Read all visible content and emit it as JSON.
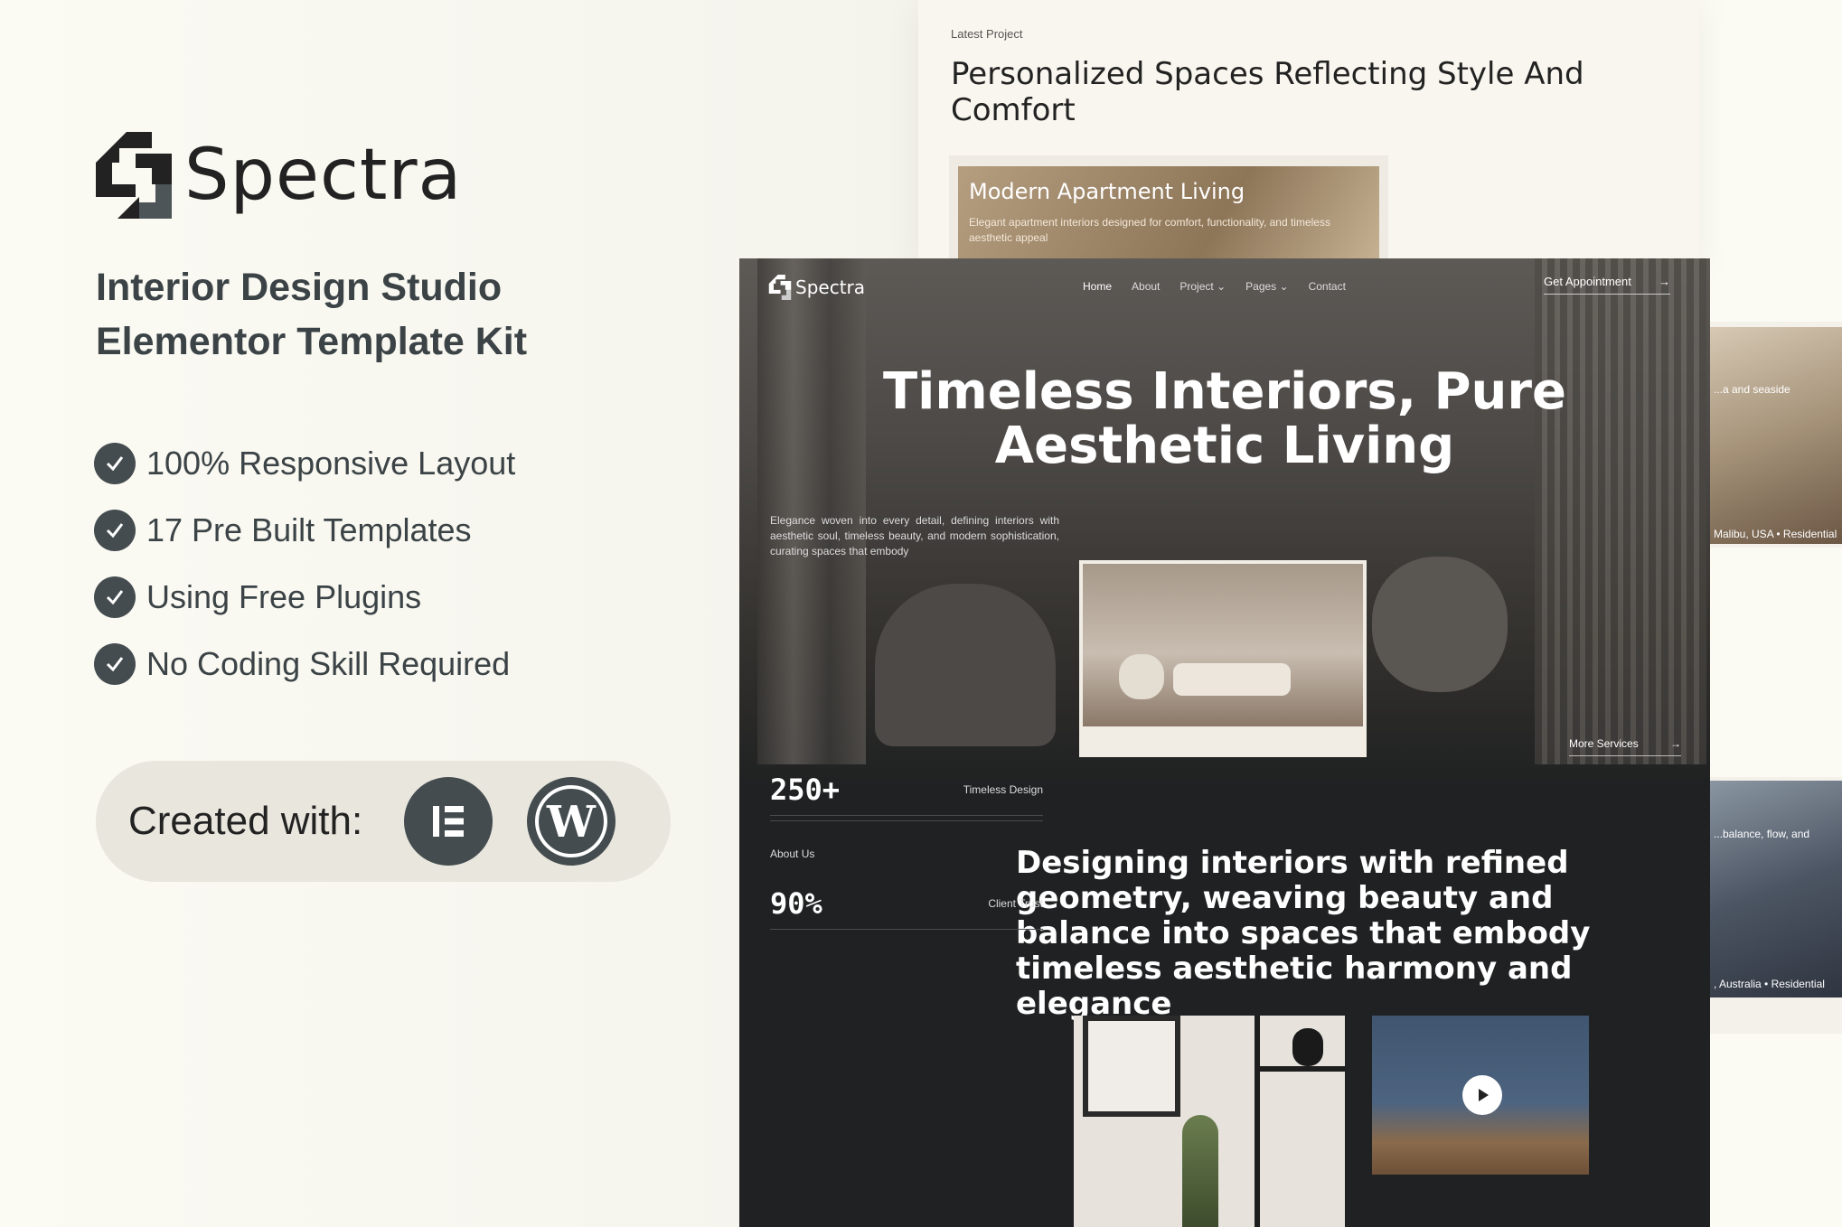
{
  "promo": {
    "brand": "Spectra",
    "subtitle_line1": "Interior Design Studio",
    "subtitle_line2": "Elementor Template Kit",
    "features": [
      "100% Responsive Layout",
      "17 Pre Built Templates",
      "Using Free Plugins",
      "No Coding Skill Required"
    ],
    "created_with": "Created with:",
    "badges": [
      "elementor-icon",
      "wordpress-icon"
    ]
  },
  "latest_project": {
    "eyebrow": "Latest Project",
    "title": "Personalized Spaces Reflecting Style And Comfort",
    "card_title": "Modern Apartment Living",
    "card_text": "Elegant apartment interiors designed for comfort, functionality, and timeless aesthetic appeal"
  },
  "peek": {
    "card1_top": "...a and seaside",
    "card1_bottom": "Malibu, USA  • Residential",
    "card2_top": "...balance, flow, and",
    "card2_bottom": ", Australia  • Residential"
  },
  "site": {
    "logo": "Spectra",
    "nav": [
      "Home",
      "About",
      "Project",
      "Pages",
      "Contact"
    ],
    "cta": "Get Appointment",
    "hero_title_line1": "Timeless Interiors, Pure",
    "hero_title_line2": "Aesthetic Living",
    "hero_text": "Elegance woven into every detail, defining interiors with aesthetic soul, timeless beauty, and modern sophistication, curating spaces that embody",
    "more_services": "More Services",
    "about_label": "About Us",
    "about_title": "Designing interiors with refined geometry, weaving beauty and balance into spaces that embody timeless aesthetic harmony and elegance",
    "stats": [
      {
        "value": "250+",
        "label": "Timeless Design"
      },
      {
        "value": "90%",
        "label": "Client Trust"
      }
    ]
  },
  "colors": {
    "background": "#fbfaf3",
    "accent": "#444c50",
    "site_dark": "#202122"
  }
}
